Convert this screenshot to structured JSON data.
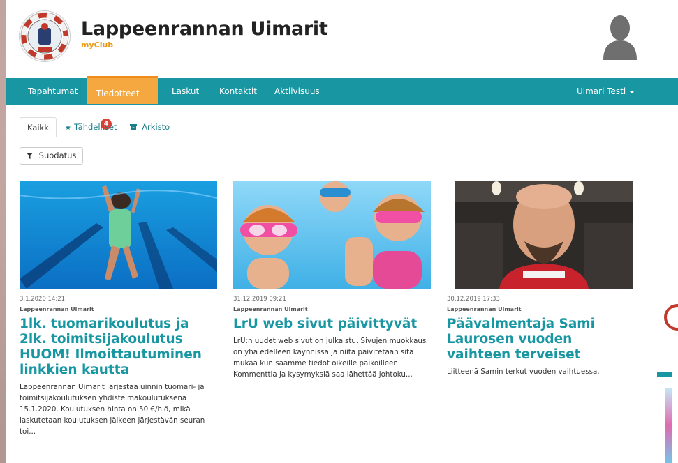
{
  "header": {
    "club_name": "Lappeenrannan Uimarit",
    "brand": "myClub"
  },
  "nav": {
    "items": [
      {
        "label": "Tapahtumat"
      },
      {
        "label": "Tiedotteet",
        "badge": "4"
      },
      {
        "label": "Laskut"
      },
      {
        "label": "Kontaktit"
      },
      {
        "label": "Aktiivisuus"
      }
    ],
    "user": "Uimari Testi"
  },
  "tabs": [
    {
      "label": "Kaikki"
    },
    {
      "label": "Tähdelliset",
      "icon": "star-icon"
    },
    {
      "label": "Arkisto",
      "icon": "archive-icon"
    }
  ],
  "filter": {
    "label": "Suodatus",
    "icon": "filter-icon"
  },
  "articles": [
    {
      "date": "3.1.2020 14:21",
      "org": "Lappeenrannan Uimarit",
      "title": "1lk. tuomarikoulutus ja 2lk. toimitsijakoulutus HUOM! Ilmoittautuminen linkkien kautta",
      "excerpt": "Lappeenrannan Uimarit järjestää uinnin tuomari- ja toimitsijakoulutuksen yhdistelmäkoulutuksena 15.1.2020. Koulutuksen hinta on 50 €/hlö, mikä laskutetaan koulutuksen jälkeen järjestävän seuran toi..."
    },
    {
      "date": "31.12.2019 09:21",
      "org": "Lappeenrannan Uimarit",
      "title": "LrU web sivut päivittyvät",
      "excerpt": "LrU:n uudet web sivut on julkaistu. Sivujen muokkaus on yhä edelleen käynnissä ja niitä päivitetään sitä mukaa kun saamme tiedot oikeille paikoilleen. Kommenttia ja kysymyksiä saa lähettää johtoku..."
    },
    {
      "date": "30.12.2019 17:33",
      "org": "Lappeenrannan Uimarit",
      "title": "Päävalmentaja Sami Laurosen vuoden vaihteen terveiset",
      "excerpt": "Liitteenä Samin terkut vuoden vaihtuessa."
    }
  ],
  "colors": {
    "primary": "#1897a3",
    "active_tab": "#f4a83f",
    "badge": "#d9433a",
    "brand": "#e89a12"
  }
}
